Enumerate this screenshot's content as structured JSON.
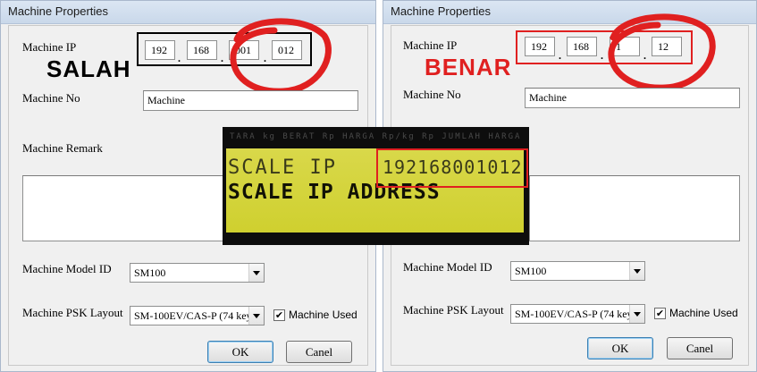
{
  "left_dialog": {
    "title": "Machine Properties",
    "machine_ip_label": "Machine IP",
    "ip": [
      "192",
      "168",
      "001",
      "012"
    ],
    "verdict": "SALAH",
    "machine_no_label": "Machine No",
    "machine_no_value": "Machine",
    "machine_remark_label": "Machine Remark",
    "model_id_label": "Machine Model ID",
    "model_id_value": "SM100",
    "psk_layout_label": "Machine PSK Layout",
    "psk_layout_value": "SM-100EV/CAS-P (74 key",
    "machine_used_label": "Machine Used",
    "machine_used_checked": "✔",
    "ok_label": "OK",
    "cancel_label": "Canel"
  },
  "right_dialog": {
    "title": "Machine Properties",
    "machine_ip_label": "Machine IP",
    "ip": [
      "192",
      "168",
      "1",
      "12"
    ],
    "verdict": "BENAR",
    "machine_no_label": "Machine No",
    "machine_no_value": "Machine",
    "model_id_label": "Machine Model ID",
    "model_id_value": "SM100",
    "psk_layout_label": "Machine PSK Layout",
    "psk_layout_value": "SM-100EV/CAS-P (74 key",
    "machine_used_label": "Machine Used",
    "machine_used_checked": "✔",
    "ok_label": "OK",
    "cancel_label": "Canel"
  },
  "lcd_photo": {
    "header_text": "TARA   kg   BERAT         Rp   HARGA      Rp/kg   Rp   JUMLAH HARGA",
    "line1": "SCALE IP",
    "line2": "SCALE IP ADDRESS",
    "ip_value": "192168001012"
  },
  "colors": {
    "annotation_red": "#e02020",
    "wrong_box": "#000000",
    "lcd_yellow": "#d4d43c"
  }
}
